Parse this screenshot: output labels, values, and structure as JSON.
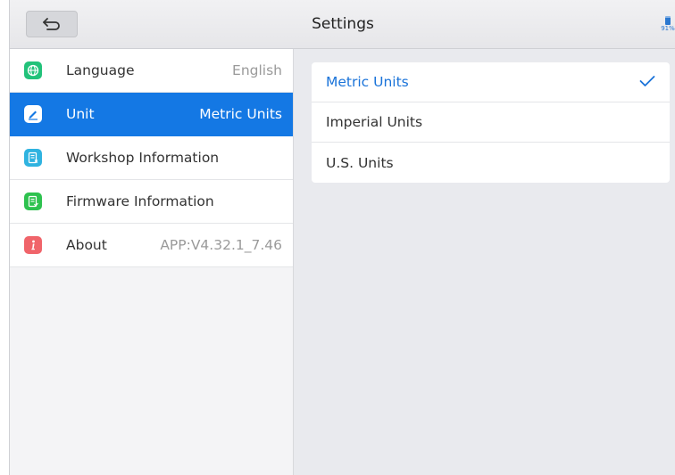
{
  "header": {
    "title": "Settings",
    "battery_pct": "91%"
  },
  "sidebar": {
    "items": [
      {
        "label": "Language",
        "value": "English",
        "icon": "globe-icon",
        "color": "#22c27a"
      },
      {
        "label": "Unit",
        "value": "Metric Units",
        "icon": "pencil-icon",
        "color": "#1478e4",
        "active": true
      },
      {
        "label": "Workshop Information",
        "value": "",
        "icon": "document-icon",
        "color": "#2fb3e0"
      },
      {
        "label": "Firmware Information",
        "value": "",
        "icon": "firmware-doc-icon",
        "color": "#2ec24f"
      },
      {
        "label": "About",
        "value": "APP:V4.32.1_7.46",
        "icon": "info-icon",
        "color": "#f0646a"
      }
    ]
  },
  "units": {
    "options": [
      {
        "label": "Metric Units",
        "selected": true
      },
      {
        "label": "Imperial Units",
        "selected": false
      },
      {
        "label": "U.S. Units",
        "selected": false
      }
    ]
  },
  "colors": {
    "accent": "#1478e4",
    "selected_text": "#1a73d9"
  }
}
